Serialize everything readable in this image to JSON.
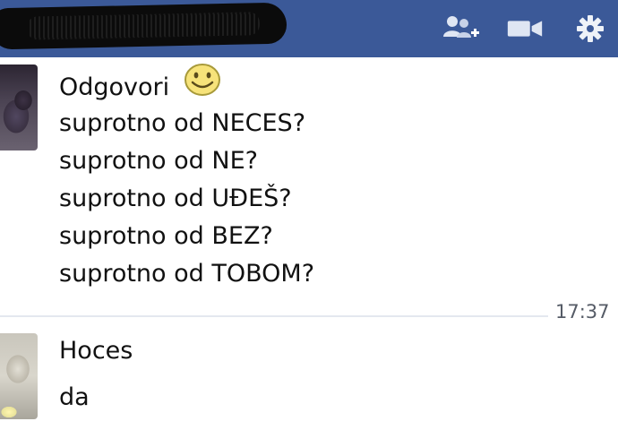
{
  "header": {
    "add_friend_icon": "add-friend-icon",
    "video_call_icon": "video-camera-icon",
    "settings_icon": "gear-icon",
    "bar_color": "#3b5998"
  },
  "messages": [
    {
      "lines": [
        "Odgovori",
        "suprotno od NECES?",
        "suprotno od NE?",
        "suprotno od UĐEŠ?",
        "suprotno od BEZ?",
        "suprotno od TOBOM?"
      ],
      "emoticon": "smiley-icon",
      "time": "17:37"
    },
    {
      "lines": [
        "Hoces",
        "da"
      ]
    }
  ]
}
